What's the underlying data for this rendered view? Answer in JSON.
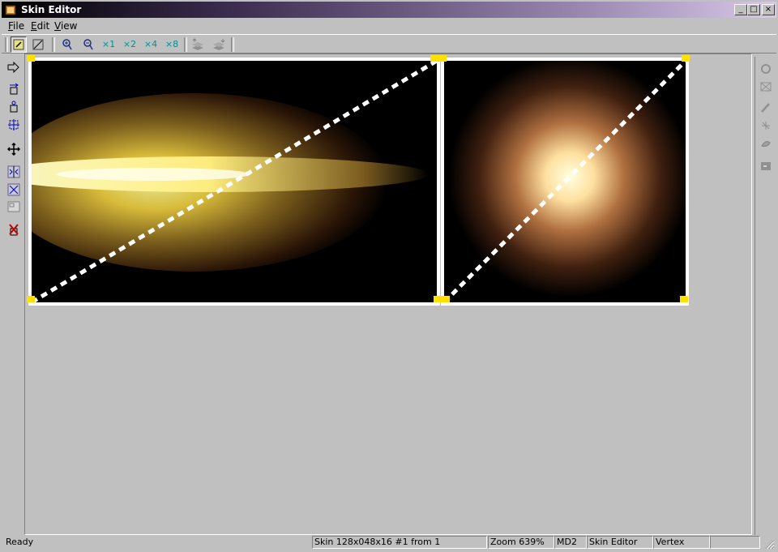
{
  "window": {
    "title": "Skin Editor"
  },
  "caption_buttons": {
    "minimize": "_",
    "maximize": "□",
    "close": "×"
  },
  "menu": [
    {
      "label": "File",
      "u": "F",
      "rest": "ile"
    },
    {
      "label": "Edit",
      "u": "E",
      "rest": "dit"
    },
    {
      "label": "View",
      "u": "V",
      "rest": "iew"
    }
  ],
  "toolbar": {
    "zoom_labels": [
      "×1",
      "×2",
      "×4",
      "×8"
    ]
  },
  "icons": {
    "left": [
      "move-icon",
      "select-vertex-icon",
      "select-triangle-icon",
      "select-all-icon",
      "pan-icon",
      "flip-horizontal-icon",
      "scale-icon",
      "grid-icon",
      "delete-icon"
    ],
    "right": [
      "rotate-icon",
      "view-icon",
      "pencil-icon",
      "clone-icon",
      "paint-icon",
      "paste-icon"
    ]
  },
  "colors": {
    "title_start": "#000000",
    "title_end": "#d8c8e8",
    "handle": "#ffe000",
    "edge": "#ffffff",
    "background": "#c0c0c0"
  },
  "statusbar": {
    "ready": "Ready",
    "skin": "Skin 128x048x16  #1 from 1",
    "zoom": "Zoom 639%",
    "format": "MD2",
    "mode": "Skin Editor",
    "selection": "Vertex"
  }
}
